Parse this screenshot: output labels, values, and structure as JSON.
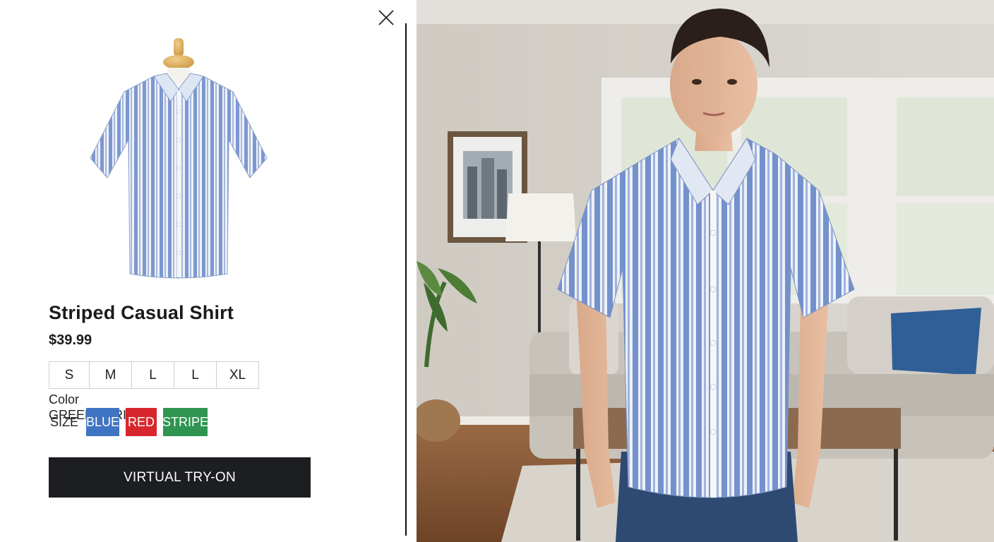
{
  "product": {
    "title": "Striped Casual Shirt",
    "price": "$39.99"
  },
  "sizes": [
    "S",
    "M",
    "L",
    "L",
    "XL"
  ],
  "color": {
    "label": "Color",
    "size_word": "SIZE",
    "options": [
      "BLUE",
      "RED",
      "STRIPE",
      "GREEN STRIPE"
    ]
  },
  "actions": {
    "try_on": "VIRTUAL TRY-ON"
  },
  "colors": {
    "blue": "#3f74c2",
    "red": "#d8262d",
    "green": "#2e9450",
    "button": "#1c1e21"
  },
  "icons": {
    "close": "close-icon"
  }
}
